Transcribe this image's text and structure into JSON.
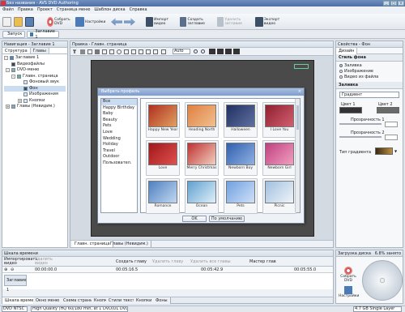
{
  "window": {
    "title": "Без названия - AVS DVD Authoring"
  },
  "menu": [
    "Файл",
    "Правка",
    "Проект",
    "Страница меню",
    "Шаблон диска",
    "Справка"
  ],
  "toolbar": {
    "burn": "Собрать DVD",
    "settings": "Настройки",
    "import": "Импорт видео",
    "add_chapter": "Создать заглавие",
    "delete_chapter": "Удалить заглавие",
    "export": "Экспорт видео"
  },
  "tabs": {
    "start": "Запуск",
    "title1": "Заглавие 1"
  },
  "navigator": {
    "header": "Навигация - Заглавие 1",
    "tabs": [
      "Структура",
      "Главы"
    ],
    "tree": [
      {
        "label": "Заглавие 1",
        "level": 0
      },
      {
        "label": "Видеофайлы",
        "level": 1
      },
      {
        "label": "DVD-меню",
        "level": 1
      },
      {
        "label": "Главн. страница",
        "level": 2
      },
      {
        "label": "Фоновый звук",
        "level": 3
      },
      {
        "label": "Фон",
        "level": 3
      },
      {
        "label": "Изображения",
        "level": 3
      },
      {
        "label": "Кнопки",
        "level": 3
      },
      {
        "label": "Главы (Невидим.)",
        "level": 1
      }
    ]
  },
  "editor": {
    "header": "Правка - Главн. страница",
    "zoom_value": "Auto",
    "bottom_tabs": [
      "Главн. страница",
      "Главы (Невидим.)"
    ]
  },
  "dialog": {
    "title": "Выбрать профиль",
    "categories": [
      "Все",
      "Happy Birthday",
      "Baby",
      "Beauty",
      "Pets",
      "Love",
      "Wedding",
      "Holiday",
      "Travel",
      "Outdoor",
      "Пользовател."
    ],
    "selected_category": "Все",
    "thumbs": [
      {
        "label": "Happy New Year",
        "color": "#b03020"
      },
      {
        "label": "Heading North",
        "color": "#e08040"
      },
      {
        "label": "Halloween",
        "color": "#203060"
      },
      {
        "label": "I Love You",
        "color": "#902030"
      },
      {
        "label": "Love",
        "color": "#a01818"
      },
      {
        "label": "Merry Christmas",
        "color": "#c03030"
      },
      {
        "label": "Newborn Boy",
        "color": "#3060b0"
      },
      {
        "label": "Newborn Girl",
        "color": "#c04080"
      },
      {
        "label": "Romance",
        "color": "#5080c0"
      },
      {
        "label": "Ocean",
        "color": "#60a0d0"
      },
      {
        "label": "Pets",
        "color": "#70a0e0"
      },
      {
        "label": "Picnic",
        "color": "#a0c0e0"
      }
    ],
    "ok": "OK",
    "default": "По умолчанию"
  },
  "properties": {
    "header": "Свойства - Фон",
    "tab": "Дизайн",
    "style_title": "Стиль фона",
    "style_options": [
      "Заливка",
      "Изображение",
      "Видео из файла"
    ],
    "fill_title": "Заливка",
    "fill_type": "Градиент",
    "color1": "Цвет 1",
    "color2": "Цвет 2",
    "opacity1": "Прозрачность 1",
    "opacity2": "Прозрачность 2",
    "gradient": "Тип градиента"
  },
  "timeline": {
    "header": "Шкала времени",
    "buttons": [
      "Импортировать видео",
      "Удалить видео",
      "Создать главу",
      "Удалить главу",
      "Удалить все главы",
      "Мастер глав"
    ],
    "times": [
      "00:00:00.0",
      "00:05:16.5",
      "00:05:42.9",
      "00:05:55.0"
    ],
    "track": "Заглавие 1",
    "bottom_tabs": [
      "Шкала времени",
      "Окно меню",
      "Схема страниц",
      "Кнопк.",
      "Стили текста",
      "Кнопки",
      "Фоны"
    ]
  },
  "burn_panel": {
    "header": "Загрузка диска",
    "percent": "6.8% занято",
    "burn": "Собрать DVD",
    "settings": "Настройки"
  },
  "status": {
    "format": "DVD NTSC",
    "quality": "High Quality (HQ 60/180 min, at 1 DVD/DL DVD Disc)",
    "disc": "4.7 GB Single Layer"
  }
}
